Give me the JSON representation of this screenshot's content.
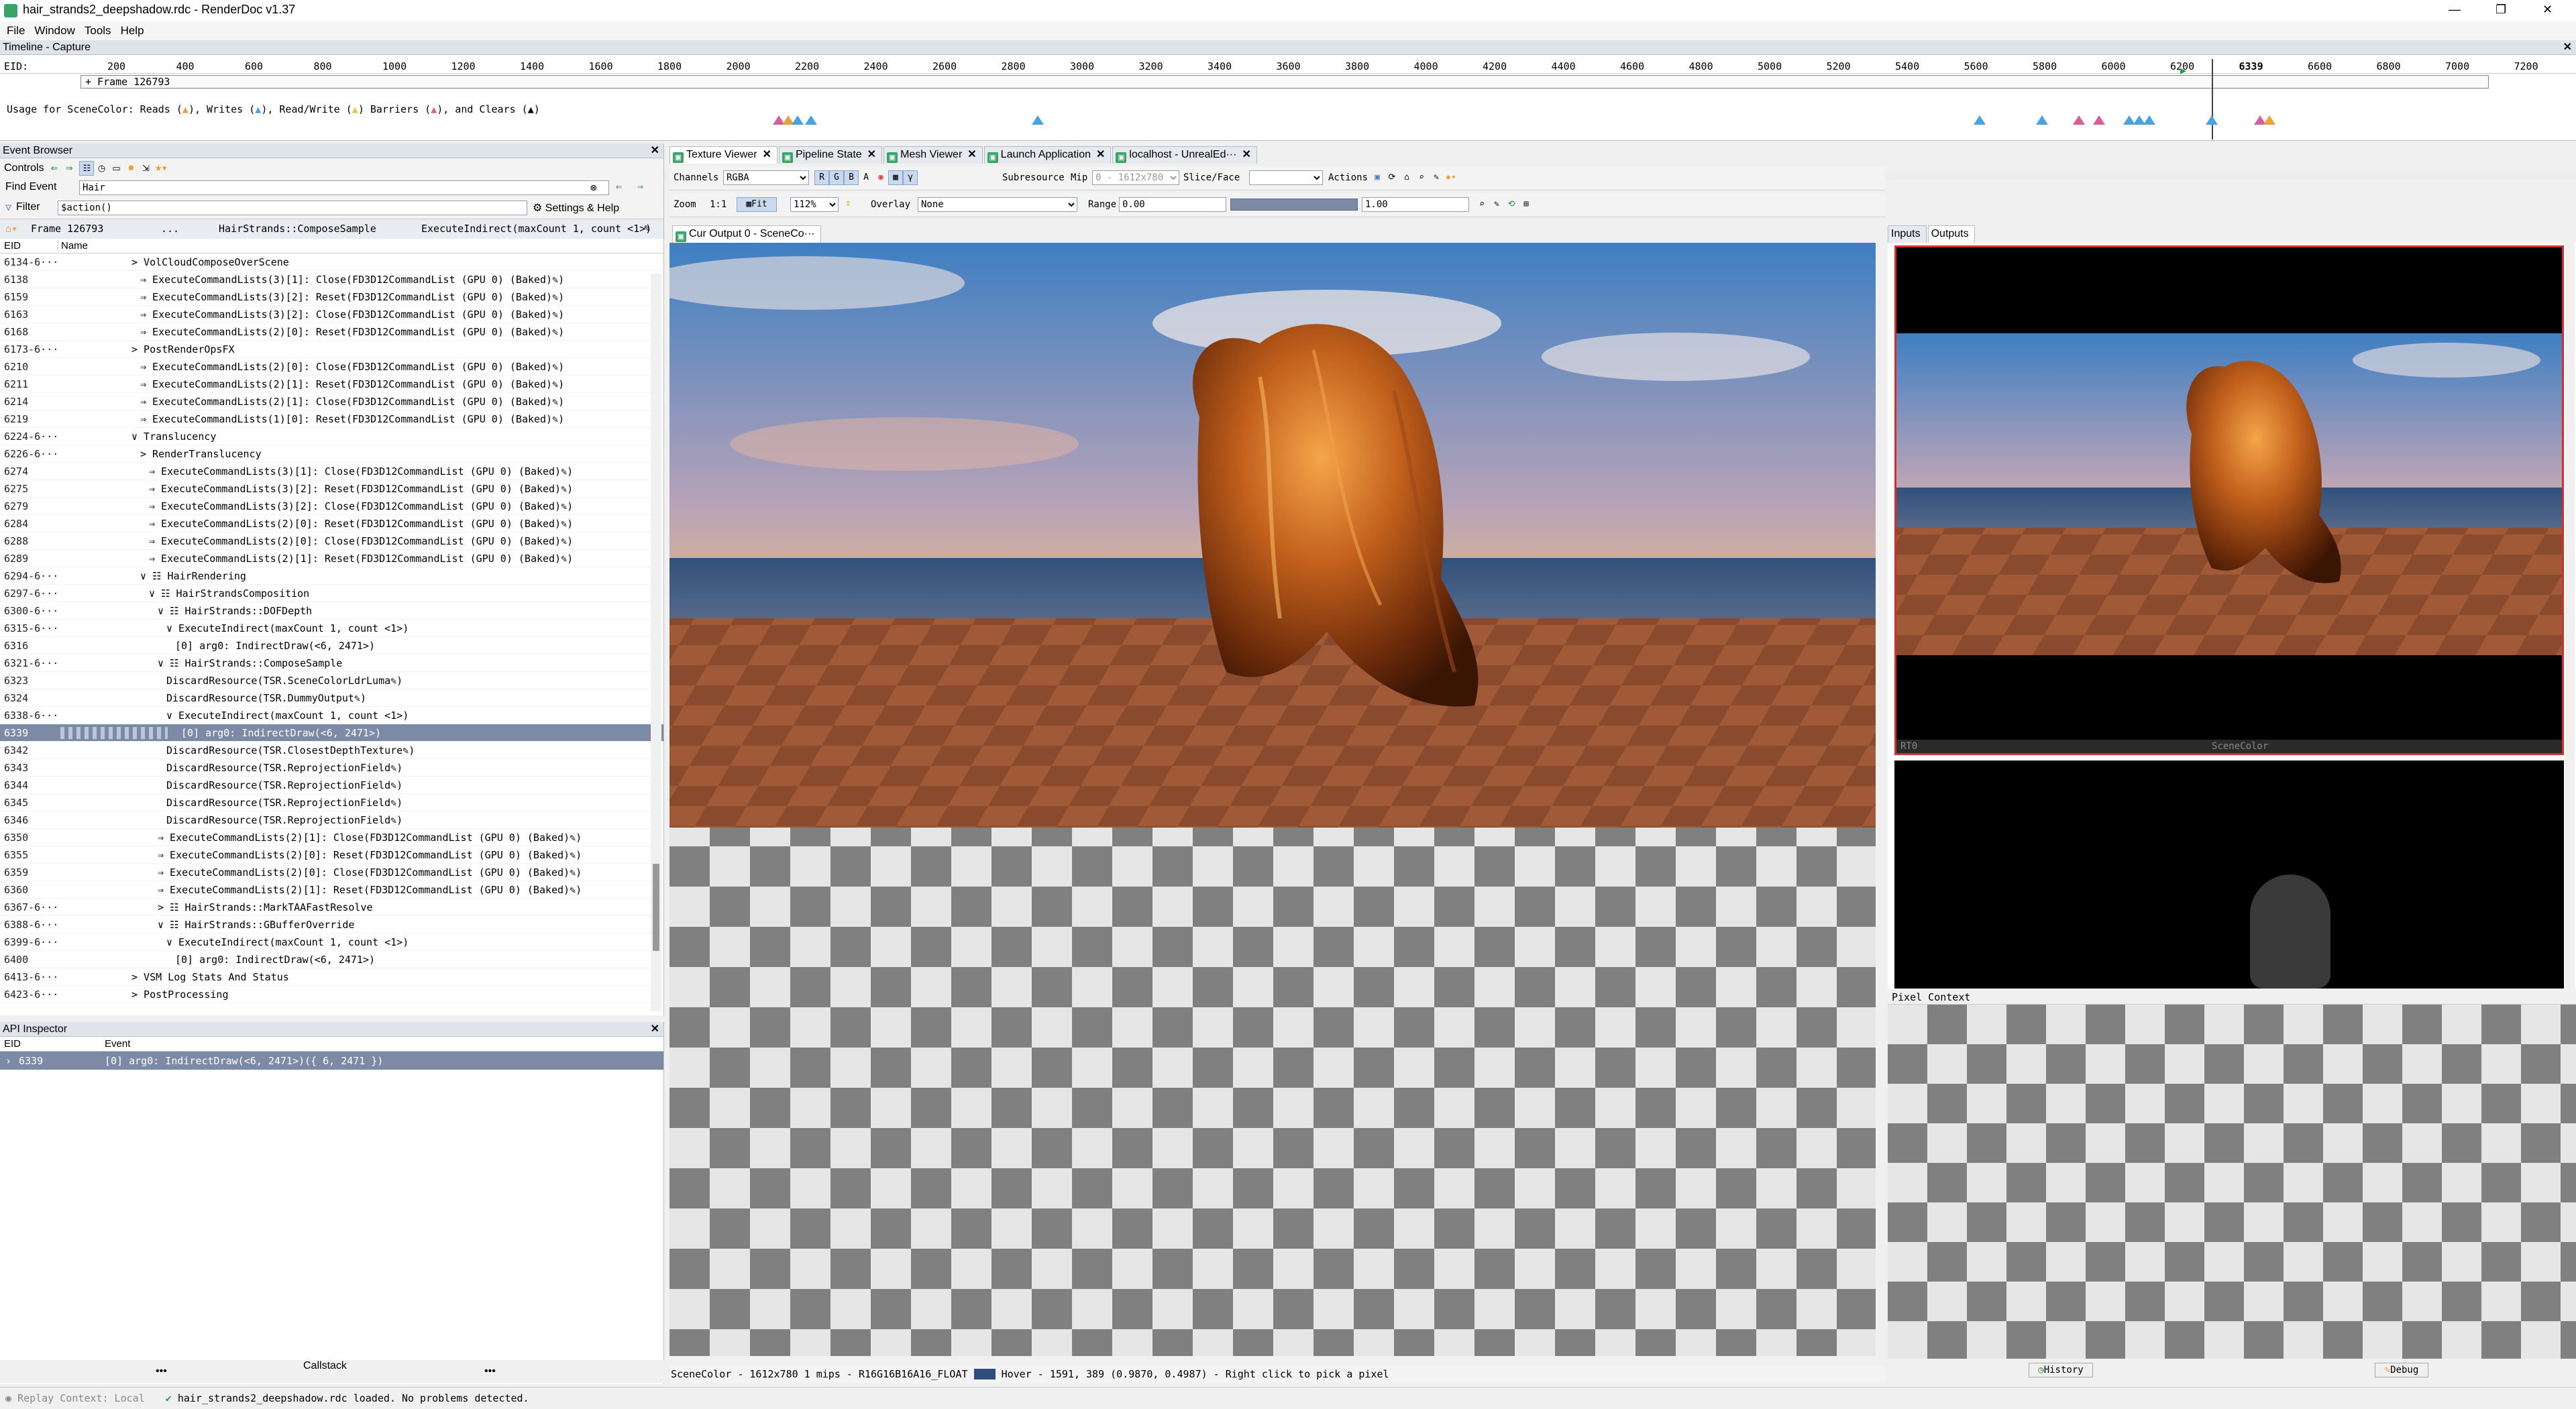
{
  "window": {
    "title": "hair_strands2_deepshadow.rdc - RenderDoc v1.37",
    "controls": [
      "—",
      "❐",
      "✕"
    ]
  },
  "menu": [
    "File",
    "Window",
    "Tools",
    "Help"
  ],
  "timeline": {
    "header": "Timeline - Capture",
    "eid_label": "EID:",
    "frame_label": "+ Frame 126793",
    "ticks": [
      "200",
      "400",
      "600",
      "800",
      "1000",
      "1200",
      "1400",
      "1600",
      "1800",
      "2000",
      "2200",
      "2400",
      "2600",
      "2800",
      "3000",
      "3200",
      "3400",
      "3600",
      "3800",
      "4000",
      "4200",
      "4400",
      "4600",
      "4800",
      "5000",
      "5200",
      "5400",
      "5600",
      "5800",
      "6000",
      "6200",
      "6339",
      "6600",
      "6800",
      "7000",
      "7200"
    ],
    "current_eid": "6339",
    "usage_text": {
      "prefix": "Usage for SceneColor: Reads (",
      "writes": "), Writes (",
      "rw": "), Read/Write (",
      "barriers": ") Barriers (",
      "clears": "), and Clears (",
      "suffix": ")"
    }
  },
  "event_browser": {
    "title": "Event Browser",
    "controls_label": "Controls",
    "find_label": "Find Event",
    "find_value": "Hair",
    "filter_label": "Filter",
    "filter_value": "$action()",
    "settings_label": "Settings & Help",
    "breadcrumb": {
      "frame": "Frame 126793",
      "ellipsis": "...",
      "crumb1": "HairStrands::ComposeSample",
      "crumb2": "ExecuteIndirect(maxCount 1, count <1>)"
    },
    "col_eid": "EID",
    "col_name": "Name",
    "rows": [
      {
        "eid": "6134-6···",
        "indent": 0,
        "text": "> VolCloudComposeOverScene"
      },
      {
        "eid": "6138",
        "indent": 1,
        "text": "⇒  ExecuteCommandLists(3)[1]:  Close(FD3D12CommandList (GPU 0) (Baked)✎)"
      },
      {
        "eid": "6159",
        "indent": 1,
        "text": "⇒  ExecuteCommandLists(3)[2]:  Reset(FD3D12CommandList (GPU 0) (Baked)✎)"
      },
      {
        "eid": "6163",
        "indent": 1,
        "text": "⇒  ExecuteCommandLists(3)[2]:  Close(FD3D12CommandList (GPU 0) (Baked)✎)"
      },
      {
        "eid": "6168",
        "indent": 1,
        "text": "⇒  ExecuteCommandLists(2)[0]:  Reset(FD3D12CommandList (GPU 0) (Baked)✎)"
      },
      {
        "eid": "6173-6···",
        "indent": 0,
        "text": "> PostRenderOpsFX"
      },
      {
        "eid": "6210",
        "indent": 1,
        "text": "⇒  ExecuteCommandLists(2)[0]:  Close(FD3D12CommandList (GPU 0) (Baked)✎)"
      },
      {
        "eid": "6211",
        "indent": 1,
        "text": "⇒  ExecuteCommandLists(2)[1]:  Reset(FD3D12CommandList (GPU 0) (Baked)✎)"
      },
      {
        "eid": "6214",
        "indent": 1,
        "text": "⇒  ExecuteCommandLists(2)[1]:  Close(FD3D12CommandList (GPU 0) (Baked)✎)"
      },
      {
        "eid": "6219",
        "indent": 1,
        "text": "⇒  ExecuteCommandLists(1)[0]:  Reset(FD3D12CommandList (GPU 0) (Baked)✎)"
      },
      {
        "eid": "6224-6···",
        "indent": 0,
        "text": "∨ Translucency"
      },
      {
        "eid": "6226-6···",
        "indent": 1,
        "text": "> RenderTranslucency"
      },
      {
        "eid": "6274",
        "indent": 2,
        "text": "⇒  ExecuteCommandLists(3)[1]:  Close(FD3D12CommandList (GPU 0) (Baked)✎)"
      },
      {
        "eid": "6275",
        "indent": 2,
        "text": "⇒  ExecuteCommandLists(3)[2]:  Reset(FD3D12CommandList (GPU 0) (Baked)✎)"
      },
      {
        "eid": "6279",
        "indent": 2,
        "text": "⇒  ExecuteCommandLists(3)[2]:  Close(FD3D12CommandList (GPU 0) (Baked)✎)"
      },
      {
        "eid": "6284",
        "indent": 2,
        "text": "⇒  ExecuteCommandLists(2)[0]:  Reset(FD3D12CommandList (GPU 0) (Baked)✎)"
      },
      {
        "eid": "6288",
        "indent": 2,
        "text": "⇒  ExecuteCommandLists(2)[0]:  Close(FD3D12CommandList (GPU 0) (Baked)✎)"
      },
      {
        "eid": "6289",
        "indent": 2,
        "text": "⇒  ExecuteCommandLists(2)[1]:  Reset(FD3D12CommandList (GPU 0) (Baked)✎)"
      },
      {
        "eid": "6294-6···",
        "indent": 1,
        "text": "∨ ☷ HairRendering"
      },
      {
        "eid": "6297-6···",
        "indent": 2,
        "text": "∨ ☷ HairStrandsComposition"
      },
      {
        "eid": "6300-6···",
        "indent": 3,
        "text": "∨ ☷ HairStrands::DOFDepth"
      },
      {
        "eid": "6315-6···",
        "indent": 4,
        "text": "∨ ExecuteIndirect(maxCount 1, count <1>)"
      },
      {
        "eid": "6316",
        "indent": 5,
        "text": "[0] arg0: IndirectDraw(<6, 2471>)"
      },
      {
        "eid": "6321-6···",
        "indent": 3,
        "text": "∨ ☷ HairStrands::ComposeSample"
      },
      {
        "eid": "6323",
        "indent": 4,
        "text": "DiscardResource(TSR.SceneColorLdrLuma✎)"
      },
      {
        "eid": "6324",
        "indent": 4,
        "text": "DiscardResource(TSR.DummyOutput✎)"
      },
      {
        "eid": "6338-6···",
        "indent": 4,
        "text": "∨ ExecuteIndirect(maxCount 1, count <1>)"
      },
      {
        "eid": "6339",
        "indent": 5,
        "text": "[0] arg0: IndirectDraw(<6, 2471>)",
        "selected": true
      },
      {
        "eid": "6342",
        "indent": 4,
        "text": "DiscardResource(TSR.ClosestDepthTexture✎)"
      },
      {
        "eid": "6343",
        "indent": 4,
        "text": "DiscardResource(TSR.ReprojectionField✎)"
      },
      {
        "eid": "6344",
        "indent": 4,
        "text": "DiscardResource(TSR.ReprojectionField✎)"
      },
      {
        "eid": "6345",
        "indent": 4,
        "text": "DiscardResource(TSR.ReprojectionField✎)"
      },
      {
        "eid": "6346",
        "indent": 4,
        "text": "DiscardResource(TSR.ReprojectionField✎)"
      },
      {
        "eid": "6350",
        "indent": 3,
        "text": "⇒  ExecuteCommandLists(2)[1]:  Close(FD3D12CommandList (GPU 0) (Baked)✎)"
      },
      {
        "eid": "6355",
        "indent": 3,
        "text": "⇒  ExecuteCommandLists(2)[0]:  Reset(FD3D12CommandList (GPU 0) (Baked)✎)"
      },
      {
        "eid": "6359",
        "indent": 3,
        "text": "⇒  ExecuteCommandLists(2)[0]:  Close(FD3D12CommandList (GPU 0) (Baked)✎)"
      },
      {
        "eid": "6360",
        "indent": 3,
        "text": "⇒  ExecuteCommandLists(2)[1]:  Reset(FD3D12CommandList (GPU 0) (Baked)✎)"
      },
      {
        "eid": "6367-6···",
        "indent": 3,
        "text": "> ☷ HairStrands::MarkTAAFastResolve"
      },
      {
        "eid": "6388-6···",
        "indent": 3,
        "text": "∨ ☷ HairStrands::GBufferOverride"
      },
      {
        "eid": "6399-6···",
        "indent": 4,
        "text": "∨ ExecuteIndirect(maxCount 1, count <1>)"
      },
      {
        "eid": "6400",
        "indent": 5,
        "text": "[0] arg0: IndirectDraw(<6, 2471>)"
      },
      {
        "eid": "6413-6···",
        "indent": 0,
        "text": "> VSM Log Stats And Status"
      },
      {
        "eid": "6423-6···",
        "indent": 0,
        "text": "> PostProcessing"
      }
    ]
  },
  "api_inspector": {
    "title": "API Inspector",
    "col_eid": "EID",
    "col_event": "Event",
    "row_eid": "6339",
    "row_event": "[0] arg0: IndirectDraw(<6, 2471>)({ 6, 2471 })",
    "callstack_label": "Callstack",
    "more": "•••"
  },
  "tabs": [
    {
      "label": "Texture Viewer",
      "active": true
    },
    {
      "label": "Pipeline State",
      "active": false
    },
    {
      "label": "Mesh Viewer",
      "active": false
    },
    {
      "label": "Launch Application",
      "active": false
    },
    {
      "label": "localhost - UnrealEd···",
      "active": false
    }
  ],
  "texture_viewer": {
    "channels_label": "Channels",
    "channels_value": "RGBA",
    "channel_buttons": [
      "R",
      "G",
      "B",
      "A"
    ],
    "subresource_label": "Subresource",
    "mip_label": "Mip",
    "mip_value": "0 - 1612x780",
    "slice_label": "Slice/Face",
    "actions_label": "Actions",
    "zoom_label": "Zoom",
    "zoom_11": "1:1",
    "fit_label": "Fit",
    "zoom_value": "112%",
    "overlay_label": "Overlay",
    "overlay_value": "None",
    "range_label": "Range",
    "range_min": "0.00",
    "range_max": "1.00",
    "subtab_label": "Cur Output 0 - SceneCo···",
    "status": "SceneColor - 1612x780 1 mips - R16G16B16A16_FLOAT",
    "hover": "Hover -    1591,  389 (0.9870, 0.4987)  - Right click to pick a pixel"
  },
  "thumbs": {
    "inputs_tab": "Inputs",
    "outputs_tab": "Outputs",
    "thumb1_left": "RT0",
    "thumb1_name": "SceneColor",
    "pixel_context_title": "Pixel Context",
    "history_label": "History",
    "debug_label": "Debug"
  },
  "statusbar": {
    "replay": "Replay Context: Local",
    "message": "hair_strands2_deepshadow.rdc loaded. No problems detected."
  }
}
